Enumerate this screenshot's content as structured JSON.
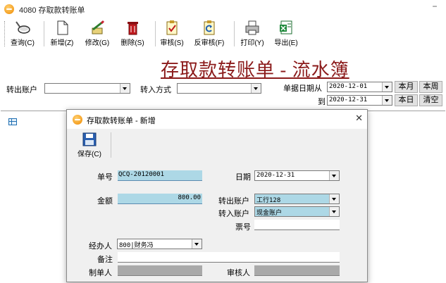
{
  "window": {
    "title": "4080 存取款转账单",
    "minimize": "−"
  },
  "toolbar": {
    "query": "查询(C)",
    "add": "新增(Z)",
    "edit": "修改(G)",
    "delete": "删除(S)",
    "audit": "审核(S)",
    "unaudit": "反审核(F)",
    "print": "打印(Y)",
    "export": "导出(E)"
  },
  "page_title": "存取款转账单 - 流水簿",
  "filter": {
    "out_account_label": "转出账户",
    "out_account_value": "",
    "transfer_method_label": "转入方式",
    "transfer_method_value": "",
    "date_from_label": "单据日期从",
    "date_from": "2020-12-01",
    "date_to_label": "到",
    "date_to": "2020-12-31",
    "btn_this_month": "本月",
    "btn_this_week": "本周",
    "btn_today": "本日",
    "btn_clear": "清空"
  },
  "dialog": {
    "title": "存取款转账单 - 新增",
    "save": "保存(C)",
    "close": "✕",
    "form": {
      "doc_no_label": "单号",
      "doc_no": "QCQ-20120001",
      "date_label": "日期",
      "date": "2020-12-31",
      "amount_label": "金额",
      "amount": "800.00",
      "out_account_label": "转出账户",
      "out_account": "工行128",
      "in_account_label": "转入账户",
      "in_account": "现金账户",
      "ticket_label": "票号",
      "ticket": "",
      "handler_label": "经办人",
      "handler": "800|财务冯",
      "remark_label": "备注",
      "remark": "",
      "maker_label": "制单人",
      "maker": "",
      "auditor_label": "审核人",
      "auditor": ""
    }
  }
}
